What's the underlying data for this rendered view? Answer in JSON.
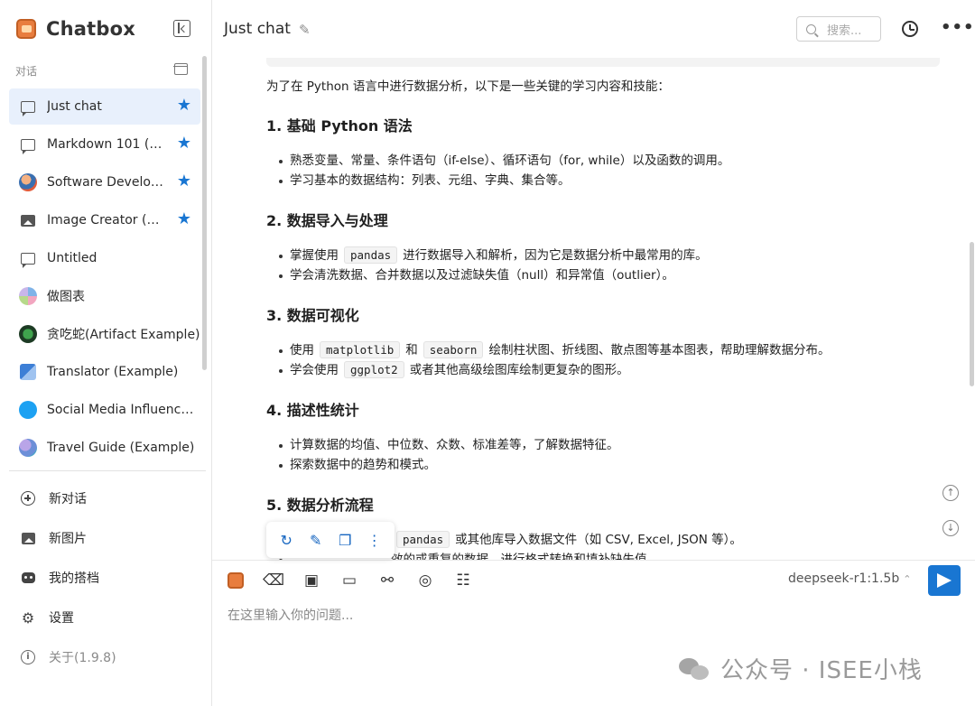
{
  "app": {
    "name": "Chatbox"
  },
  "sidebar": {
    "section_label": "对话",
    "sessions": [
      {
        "label": "Just chat",
        "starred": true,
        "active": true,
        "icon": "chat-bubble-icon"
      },
      {
        "label": "Markdown 101 (Ex...",
        "starred": true,
        "icon": "chat-bubble-icon"
      },
      {
        "label": "Software Develop...",
        "starred": true,
        "icon": "developer-avatar-icon"
      },
      {
        "label": "Image Creator (Ex...",
        "starred": true,
        "icon": "image-icon"
      },
      {
        "label": "Untitled",
        "starred": false,
        "icon": "chat-bubble-icon"
      },
      {
        "label": "做图表",
        "starred": false,
        "icon": "chart-avatar-icon"
      },
      {
        "label": "贪吃蛇(Artifact Example)",
        "starred": false,
        "icon": "snake-avatar-icon"
      },
      {
        "label": "Translator (Example)",
        "starred": false,
        "icon": "translator-avatar-icon"
      },
      {
        "label": "Social Media Influencer ...",
        "starred": false,
        "icon": "twitter-icon"
      },
      {
        "label": "Travel Guide (Example)",
        "starred": false,
        "icon": "globe-avatar-icon"
      }
    ],
    "actions": [
      {
        "label": "新对话",
        "icon": "plus-circle-icon"
      },
      {
        "label": "新图片",
        "icon": "new-image-icon"
      },
      {
        "label": "我的搭档",
        "icon": "robot-icon"
      },
      {
        "label": "设置",
        "icon": "gear-icon"
      },
      {
        "label": "关于(1.9.8)",
        "icon": "info-icon"
      }
    ]
  },
  "header": {
    "title": "Just chat",
    "search_placeholder": "搜索..."
  },
  "message": {
    "intro": "为了在 Python 语言中进行数据分析，以下是一些关键的学习内容和技能：",
    "sections": [
      {
        "heading": "1. 基础 Python 语法",
        "b1": "熟悉变量、常量、条件语句（if-else）、循环语句（for, while）以及函数的调用。",
        "b2": "学习基本的数据结构：列表、元组、字典、集合等。"
      },
      {
        "heading": "2. 数据导入与处理",
        "b1_pre": "掌握使用",
        "b1_code": "pandas",
        "b1_post": "进行数据导入和解析，因为它是数据分析中最常用的库。",
        "b2": "学会清洗数据、合并数据以及过滤缺失值（null）和异常值（outlier）。"
      },
      {
        "heading": "3. 数据可视化",
        "b1_pre": "使用",
        "b1_code1": "matplotlib",
        "b1_mid": "和",
        "b1_code2": "seaborn",
        "b1_post": "绘制柱状图、折线图、散点图等基本图表，帮助理解数据分布。",
        "b2_pre": "学会使用",
        "b2_code": "ggplot2",
        "b2_post": "或者其他高级绘图库绘制更复杂的图形。"
      },
      {
        "heading": "4. 描述性统计",
        "b1": "计算数据的均值、中位数、众数、标准差等，了解数据特征。",
        "b2": "探索数据中的趋势和模式。"
      },
      {
        "heading": "5. 数据分析流程",
        "b1_code": "pandas",
        "b1_post": "或其他库导入数据文件（如 CSV, Excel, JSON 等）。",
        "b2": "效的或重复的数据，进行格式转换和填补缺失值。"
      }
    ]
  },
  "composer": {
    "model": "deepseek-r1:1.5b",
    "input_placeholder": "在这里输入你的问题..."
  },
  "watermark": {
    "text": "公众号 · ISEE小栈"
  },
  "colors": {
    "accent": "#1976d2",
    "active_bg": "#e8f0fc",
    "brand": "#e87d3e"
  }
}
